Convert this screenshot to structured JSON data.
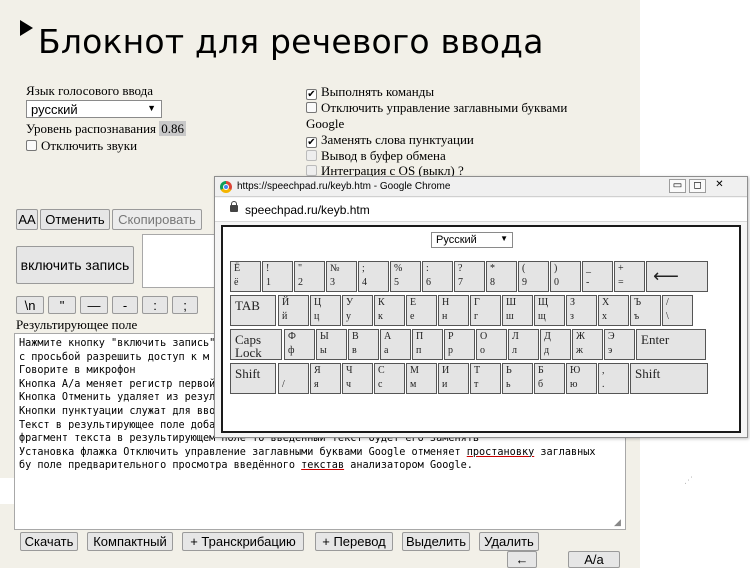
{
  "title": "Блокнот для речевого ввода",
  "language_label": "Язык голосового ввода",
  "language_value": "русский",
  "recognition_label": "Уровень распознавания",
  "recognition_value": "0.86",
  "mute_sounds_label": "Отключить звуки",
  "options": {
    "run_commands": "Выполнять команды",
    "disable_caps": "Отключить управление заглавными буквами",
    "google_header": "Google",
    "replace_punct": "Заменять слова пунктуации",
    "clipboard": "Вывод в буфер обмена",
    "os_integration": "Интеграция с OS (выкл)",
    "os_help": "?"
  },
  "toolbar": {
    "aa": "AA",
    "cancel": "Отменить",
    "copy": "Скопировать"
  },
  "record_button": "включить запись",
  "punct_buttons": [
    "\\n",
    "\"",
    "—",
    "-",
    ":",
    ";"
  ],
  "result_label": "Результирующее поле",
  "result_lines": [
    "Нажмите кнопку \"включить запись\"",
    "с просьбой разрешить доступ к м",
    "Говорите в микрофон",
    "Кнопка А/а меняет регистр первой",
    "Кнопка Отменить удаляет из резул",
    "Кнопки пунктуации служат для вво",
    "Текст в результирующее поле доба",
    "фрагмент текста в результирующем поле то введенный текст будет его заменять",
    "Установка флажка Отключить управление заглавными буквами Google отменяет ",
    "бу поле предварительного просмотра введённого ",
    " анализатором Google."
  ],
  "result_underlined": {
    "line9_word": "простановку",
    "line9_tail": " заглавных",
    "line10_word": "текстав"
  },
  "bottom_buttons": [
    "Скачать",
    "Компактный",
    "+ Транскрибацию",
    "+ Перевод",
    "Выделить",
    "Удалить"
  ],
  "bottom_row2": {
    "left_arrow": "←",
    "aa": "A/a"
  },
  "popup": {
    "window_title": "https://speechpad.ru/keyb.htm - Google Chrome",
    "url": "speechpad.ru/keyb.htm",
    "language_select": "Русский",
    "minimize": "▭",
    "restore": "◻",
    "close": "✕"
  },
  "keyboard": {
    "row1": [
      {
        "t": "Ё",
        "b": "ё"
      },
      {
        "t": "!",
        "b": "1"
      },
      {
        "t": "\"",
        "b": "2"
      },
      {
        "t": "№",
        "b": "3"
      },
      {
        "t": ";",
        "b": "4"
      },
      {
        "t": "%",
        "b": "5"
      },
      {
        "t": ":",
        "b": "6"
      },
      {
        "t": "?",
        "b": "7"
      },
      {
        "t": "*",
        "b": "8"
      },
      {
        "t": "(",
        "b": "9"
      },
      {
        "t": ")",
        "b": "0"
      },
      {
        "t": "_",
        "b": "-"
      },
      {
        "t": "+",
        "b": "="
      }
    ],
    "backspace": "⟵",
    "tab": "TAB",
    "row2": [
      {
        "t": "Й",
        "b": "й"
      },
      {
        "t": "Ц",
        "b": "ц"
      },
      {
        "t": "У",
        "b": "у"
      },
      {
        "t": "К",
        "b": "к"
      },
      {
        "t": "Е",
        "b": "е"
      },
      {
        "t": "Н",
        "b": "н"
      },
      {
        "t": "Г",
        "b": "г"
      },
      {
        "t": "Ш",
        "b": "ш"
      },
      {
        "t": "Щ",
        "b": "щ"
      },
      {
        "t": "З",
        "b": "з"
      },
      {
        "t": "Х",
        "b": "х"
      },
      {
        "t": "Ъ",
        "b": "ъ"
      },
      {
        "t": "/",
        "b": "\\"
      }
    ],
    "caps_top": "Caps",
    "caps_bottom": "Lock",
    "row3": [
      {
        "t": "Ф",
        "b": "ф"
      },
      {
        "t": "Ы",
        "b": "ы"
      },
      {
        "t": "В",
        "b": "в"
      },
      {
        "t": "А",
        "b": "а"
      },
      {
        "t": "П",
        "b": "п"
      },
      {
        "t": "Р",
        "b": "р"
      },
      {
        "t": "О",
        "b": "о"
      },
      {
        "t": "Л",
        "b": "л"
      },
      {
        "t": "Д",
        "b": "д"
      },
      {
        "t": "Ж",
        "b": "ж"
      },
      {
        "t": "Э",
        "b": "э"
      }
    ],
    "enter": "Enter",
    "shift": "Shift",
    "row4": [
      {
        "t": "",
        "b": "/"
      },
      {
        "t": "Я",
        "b": "я"
      },
      {
        "t": "Ч",
        "b": "ч"
      },
      {
        "t": "С",
        "b": "с"
      },
      {
        "t": "М",
        "b": "м"
      },
      {
        "t": "И",
        "b": "и"
      },
      {
        "t": "Т",
        "b": "т"
      },
      {
        "t": "Ь",
        "b": "ь"
      },
      {
        "t": "Б",
        "b": "б"
      },
      {
        "t": "Ю",
        "b": "ю"
      },
      {
        "t": ",",
        "b": "."
      }
    ]
  }
}
